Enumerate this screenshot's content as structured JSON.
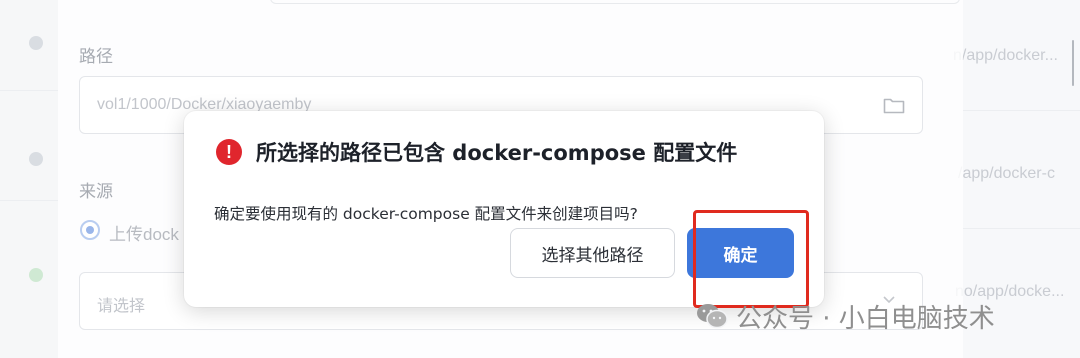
{
  "background": {
    "path_label": "路径",
    "path_value": "vol1/1000/Docker/xiaoyaemby",
    "source_label": "来源",
    "radio_upload_label": "上传dock",
    "select_placeholder": "请选择",
    "right_column_paths": [
      "n/app/docker...",
      "/app/docker-c",
      "no/app/docke..."
    ]
  },
  "dialog": {
    "title": "所选择的路径已包含 docker-compose 配置文件",
    "message": "确定要使用现有的 docker-compose 配置文件来创建项目吗?",
    "secondary_button": "选择其他路径",
    "primary_button": "确定",
    "error_icon_glyph": "!"
  },
  "watermark": {
    "text": "公众号 · 小白电脑技术"
  },
  "colors": {
    "primary": "#3d77db",
    "danger": "#e0262d",
    "annotation": "#e02a1e"
  }
}
